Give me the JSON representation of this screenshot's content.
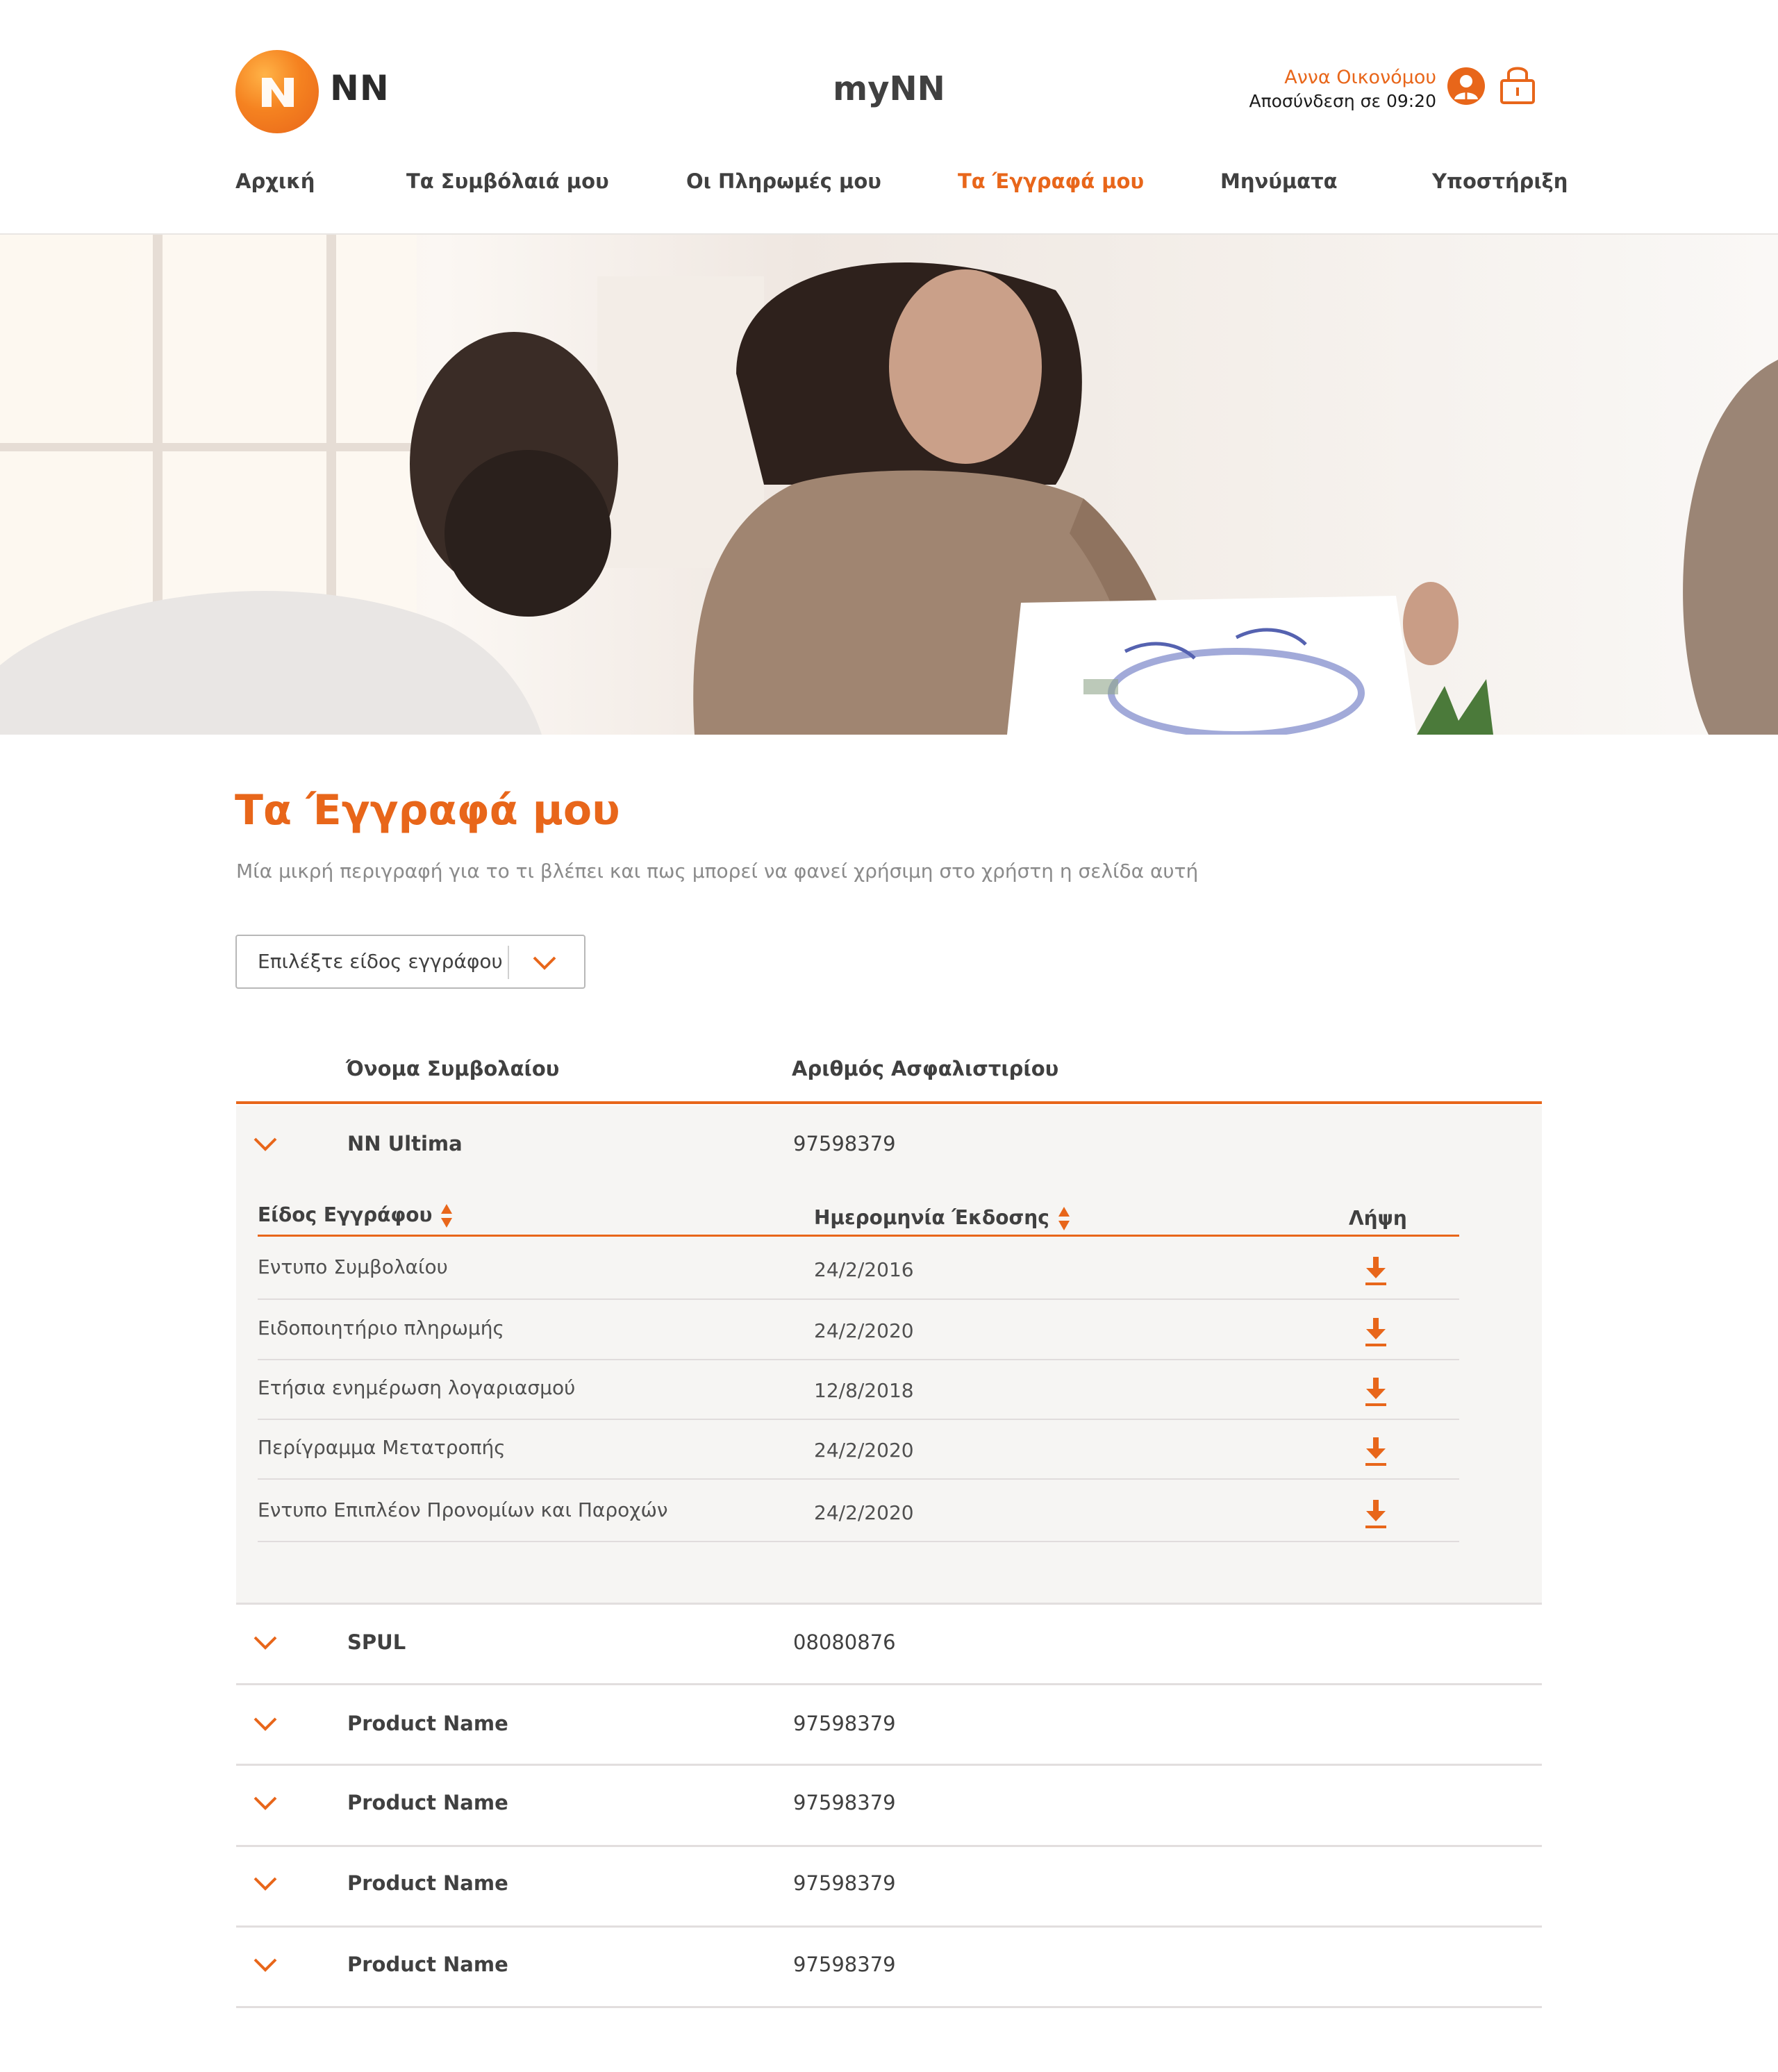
{
  "brand": {
    "logo_text": "NN",
    "app_title": "myNN",
    "accent": "#e8661a"
  },
  "user": {
    "name": "Αννα Οικονόμου",
    "logout_text": "Αποσύνδεση σε 09:20"
  },
  "nav": [
    {
      "label": "Αρχική",
      "active": false
    },
    {
      "label": "Τα Συμβόλαιά μου",
      "active": false
    },
    {
      "label": "Οι Πληρωμές μου",
      "active": false
    },
    {
      "label": "Τα Έγγραφά μου",
      "active": true
    },
    {
      "label": "Μηνύματα",
      "active": false
    },
    {
      "label": "Υποστήριξη",
      "active": false
    }
  ],
  "page": {
    "title": "Τα  Έγγραφά μου",
    "description": "Μία μικρή περιγραφή για το τι βλέπει και πως μπορεί να φανεί χρήσιμη στο χρήστη η σελίδα αυτή",
    "filter_placeholder": "Επιλέξτε είδος εγγράφου"
  },
  "table": {
    "headers": {
      "name": "Όνομα Συμβολαίου",
      "number": "Αριθμός Ασφαλιστιρίου"
    },
    "expanded": {
      "name": "NN Ultima",
      "number": "97598379",
      "sub_headers": {
        "type": "Είδος Εγγράφου",
        "date": "Ημερομηνία Έκδοσης",
        "download": "Λήψη"
      },
      "documents": [
        {
          "type": "Εντυπο Συμβολαίου",
          "date": "24/2/2016"
        },
        {
          "type": "Ειδοποιητήριο πληρωμής",
          "date": "24/2/2020"
        },
        {
          "type": "Ετήσια ενημέρωση λογαριασμού",
          "date": "12/8/2018"
        },
        {
          "type": "Περίγραμμα Μετατροπής",
          "date": "24/2/2020"
        },
        {
          "type": "Εντυπο Επιπλέον Προνομίων και Παροχών",
          "date": "24/2/2020"
        }
      ]
    },
    "rows": [
      {
        "name": "SPUL",
        "number": "08080876"
      },
      {
        "name": "Product Name",
        "number": "97598379"
      },
      {
        "name": "Product Name",
        "number": "97598379"
      },
      {
        "name": "Product Name",
        "number": "97598379"
      },
      {
        "name": "Product Name",
        "number": "97598379"
      }
    ]
  }
}
